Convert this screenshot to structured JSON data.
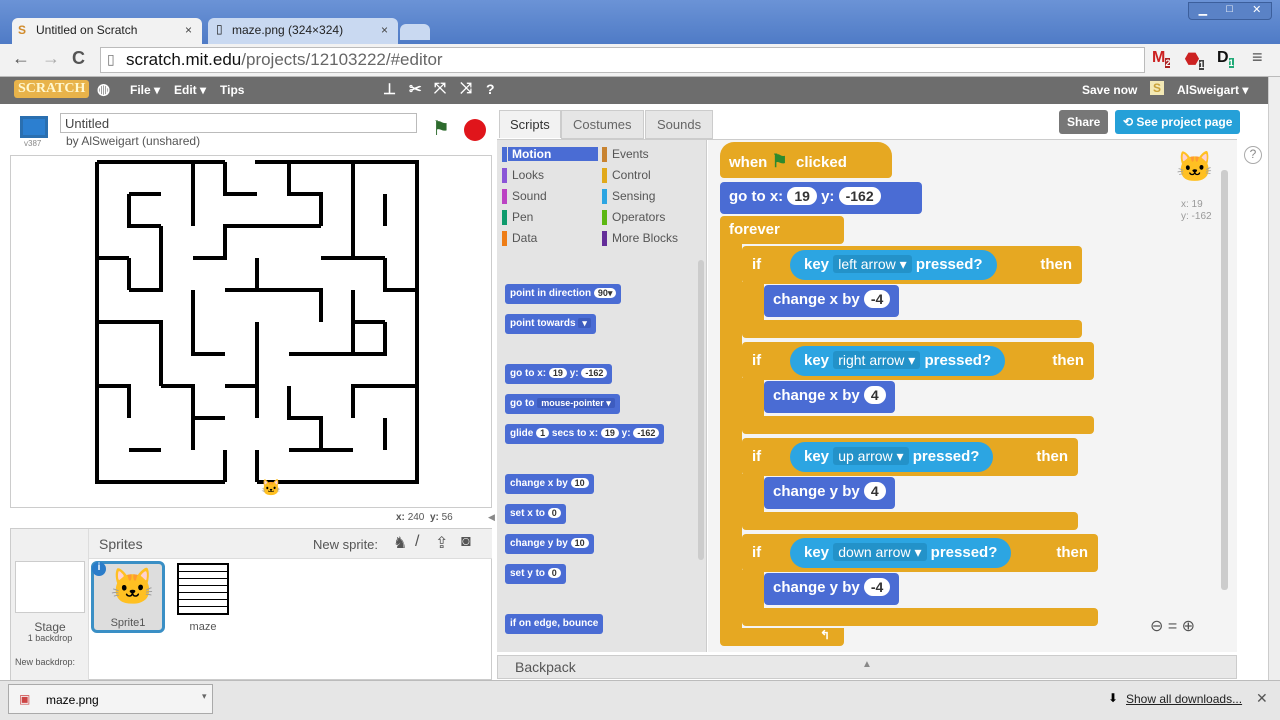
{
  "browser": {
    "tabs": [
      {
        "label": "Untitled on Scratch",
        "active": true
      },
      {
        "label": "maze.png (324×324)",
        "active": false
      }
    ],
    "url_host": "scratch.mit.edu",
    "url_path": "/projects/12103222/#editor",
    "ext_badges": [
      "2",
      "1",
      "1"
    ]
  },
  "menubar": {
    "logo": "SCRATCH",
    "items": [
      "File ▾",
      "Edit ▾",
      "Tips"
    ],
    "save_now": "Save now",
    "user": "AlSweigart ▾"
  },
  "project": {
    "title": "Untitled",
    "byline": "by AlSweigart (unshared)",
    "version": "v387",
    "share": "Share",
    "see_project_page": "See project page"
  },
  "stage": {
    "mouse_x_label": "x:",
    "mouse_x": "240",
    "mouse_y_label": "y:",
    "mouse_y": "56"
  },
  "tabs": [
    "Scripts",
    "Costumes",
    "Sounds"
  ],
  "categories": [
    {
      "label": "Motion",
      "color": "#4a6cd4",
      "active": true
    },
    {
      "label": "Events",
      "color": "#c88330"
    },
    {
      "label": "Looks",
      "color": "#8a55d7"
    },
    {
      "label": "Control",
      "color": "#e1a91a"
    },
    {
      "label": "Sound",
      "color": "#bb42c3"
    },
    {
      "label": "Sensing",
      "color": "#2ca5e2"
    },
    {
      "label": "Pen",
      "color": "#0e9a6c"
    },
    {
      "label": "Operators",
      "color": "#5cb712"
    },
    {
      "label": "Data",
      "color": "#ee7d16"
    },
    {
      "label": "More Blocks",
      "color": "#632d99"
    }
  ],
  "palette": {
    "point_dir": "point in direction",
    "point_dir_v": "90▾",
    "point_towards": "point towards",
    "point_towards_v": "▾",
    "goto": "go to x:",
    "goto_x": "19",
    "y": "y:",
    "goto_y": "-162",
    "goto_target": "go to",
    "goto_target_v": "mouse-pointer ▾",
    "glide": "glide",
    "glide_secs": "1",
    "glide_mid": "secs to x:",
    "glide_x": "19",
    "glide_y": "-162",
    "change_x": "change x by",
    "change_x_v": "10",
    "set_x": "set x to",
    "set_x_v": "0",
    "change_y": "change y by",
    "change_y_v": "10",
    "set_y": "set y to",
    "set_y_v": "0",
    "bounce": "if on edge, bounce"
  },
  "script": {
    "when": "when",
    "clicked": "clicked",
    "goto": "go to x:",
    "x": "19",
    "y_label": "y:",
    "y": "-162",
    "forever": "forever",
    "ifs": [
      {
        "if": "if",
        "key": "key",
        "option": "left arrow",
        "pressed": "pressed?",
        "then": "then",
        "action": "change x by",
        "value": "-4"
      },
      {
        "if": "if",
        "key": "key",
        "option": "right arrow",
        "pressed": "pressed?",
        "then": "then",
        "action": "change x by",
        "value": "4"
      },
      {
        "if": "if",
        "key": "key",
        "option": "up arrow",
        "pressed": "pressed?",
        "then": "then",
        "action": "change y by",
        "value": "4"
      },
      {
        "if": "if",
        "key": "key",
        "option": "down arrow",
        "pressed": "pressed?",
        "then": "then",
        "action": "change y by",
        "value": "-4"
      }
    ]
  },
  "sprite_info": {
    "x": "x: 19",
    "y": "y: -162"
  },
  "sprites": {
    "header": "Sprites",
    "new_sprite": "New sprite:",
    "stage_label": "Stage",
    "backdrops": "1 backdrop",
    "new_backdrop": "New backdrop:",
    "items": [
      "Sprite1",
      "maze"
    ]
  },
  "backpack": "Backpack",
  "downloads": {
    "file": "maze.png",
    "show_all": "Show all downloads..."
  }
}
